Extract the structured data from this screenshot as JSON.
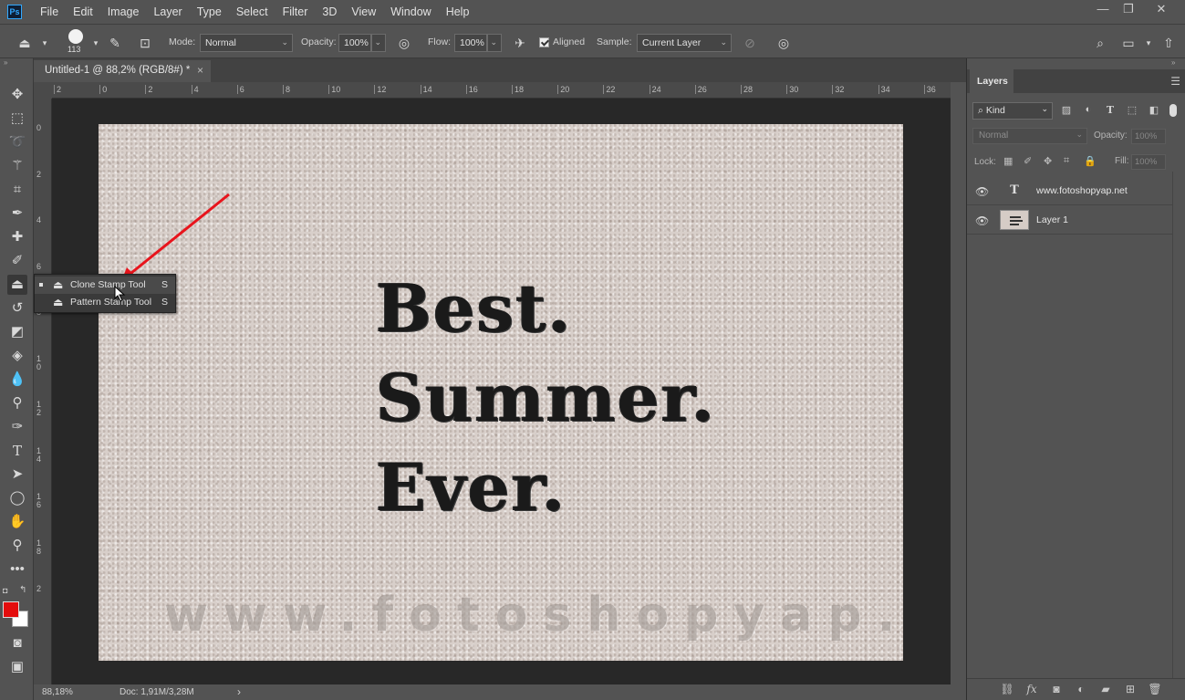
{
  "app": {
    "logo_text": "Ps",
    "menu": [
      "File",
      "Edit",
      "Image",
      "Layer",
      "Type",
      "Select",
      "Filter",
      "3D",
      "View",
      "Window",
      "Help"
    ],
    "window_controls": {
      "minimize": "—",
      "restore": "❐",
      "close": "✕"
    }
  },
  "options": {
    "brush_size": "113",
    "mode_label": "Mode:",
    "mode_value": "Normal",
    "opacity_label": "Opacity:",
    "opacity_value": "100%",
    "flow_label": "Flow:",
    "flow_value": "100%",
    "aligned_label": "Aligned",
    "sample_label": "Sample:",
    "sample_value": "Current Layer"
  },
  "document": {
    "tab_title": "Untitled-1 @ 88,2% (RGB/8#) *",
    "close_glyph": "×",
    "zoom_status": "88,18%",
    "doc_status": "Doc: 1,91M/3,28M",
    "status_arrow": "›"
  },
  "rulers": {
    "horizontal": [
      "2",
      "0",
      "2",
      "4",
      "6",
      "8",
      "10",
      "12",
      "14",
      "16",
      "18",
      "20",
      "22",
      "24",
      "26",
      "28",
      "30",
      "32",
      "34",
      "36"
    ],
    "vertical": [
      "0",
      "2",
      "4",
      "6",
      "8",
      "1\n0",
      "1\n2",
      "1\n4",
      "1\n6",
      "1\n8",
      "2"
    ]
  },
  "canvas": {
    "line1": "Best.",
    "line2": "Summer.",
    "line3": "Ever.",
    "watermark": "www.fotoshopyap.net"
  },
  "flyout": {
    "items": [
      {
        "label": "Clone Stamp Tool",
        "key": "S"
      },
      {
        "label": "Pattern Stamp Tool",
        "key": "S"
      }
    ]
  },
  "layers_panel": {
    "tab": "Layers",
    "kind_label": "Kind",
    "blend_mode": "Normal",
    "opacity_label": "Opacity:",
    "opacity_value": "100%",
    "lock_label": "Lock:",
    "fill_label": "Fill:",
    "fill_value": "100%",
    "layers": [
      {
        "name": "www.fotoshopyap.net",
        "type": "text",
        "thumb_glyph": "T"
      },
      {
        "name": "Layer 1",
        "type": "image"
      }
    ]
  },
  "colors": {
    "foreground": "#e40d0d",
    "background": "#ffffff",
    "arrow": "#e8141c"
  }
}
